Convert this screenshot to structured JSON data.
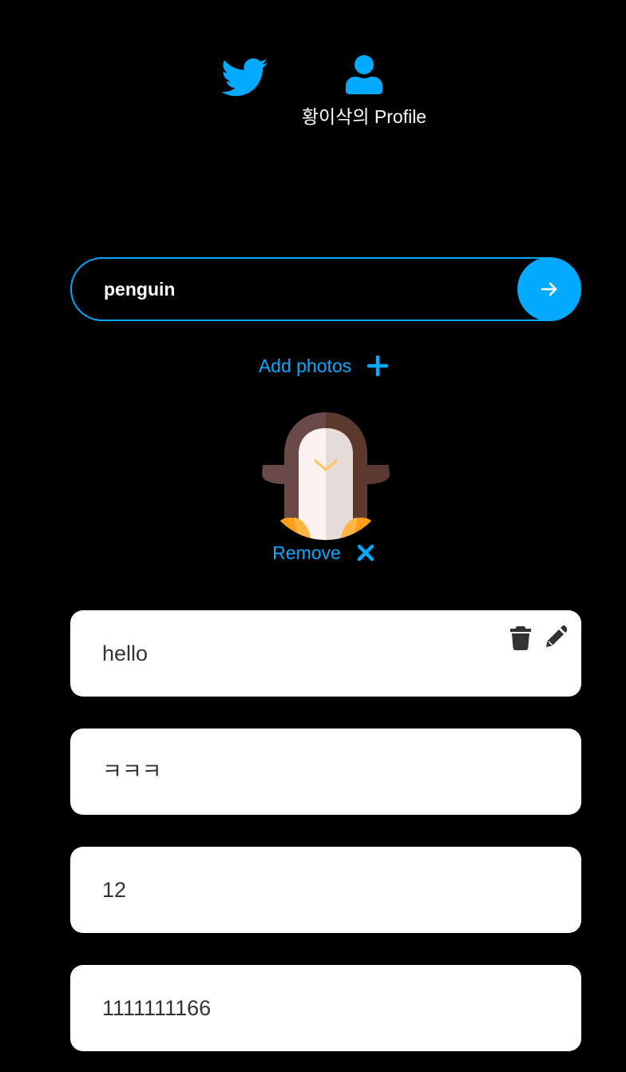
{
  "nav": {
    "home_icon": "twitter-bird-icon",
    "profile_icon": "user-icon",
    "profile_label": "황이삭의 Profile"
  },
  "tweet_form": {
    "input_value": "penguin",
    "submit_icon": "arrow-right-icon",
    "add_photos_label": "Add photos",
    "add_photos_icon": "plus-icon"
  },
  "attachment": {
    "image": "penguin-illustration",
    "remove_label": "Remove",
    "remove_icon": "x-icon"
  },
  "tweets": [
    {
      "text": "hello",
      "actions": [
        "trash-icon",
        "pencil-icon"
      ]
    },
    {
      "text": "ㅋㅋㅋ"
    },
    {
      "text": "12"
    },
    {
      "text": "1111111166"
    }
  ],
  "colors": {
    "accent": "#04aaff",
    "background": "#000000",
    "card": "#ffffff",
    "card_text": "#333333"
  }
}
